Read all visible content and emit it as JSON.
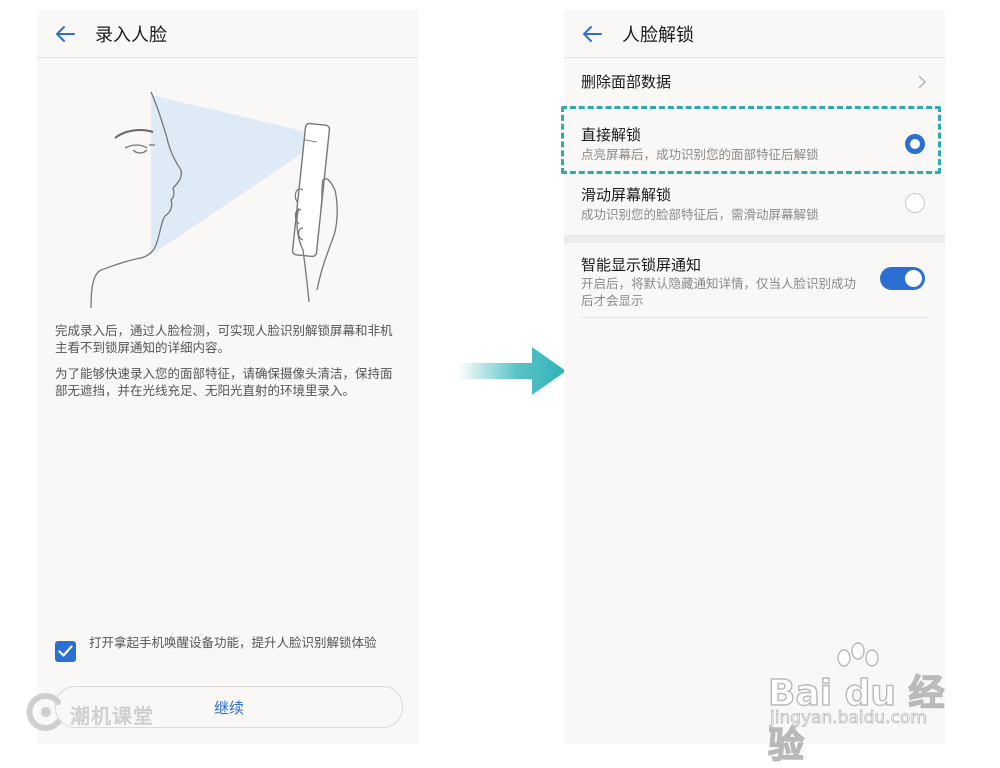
{
  "left_screen": {
    "title": "录入人脸",
    "description_1": "完成录入后，通过人脸检测，可实现人脸识别解锁屏幕和非机主看不到锁屏通知的详细内容。",
    "description_2": "为了能够快速录入您的面部特征，请确保摄像头清洁，保持面部无遮挡，并在光线充足、无阳光直射的环境里录入。",
    "checkbox_label": "打开拿起手机唤醒设备功能，提升人脸识别解锁体验",
    "checkbox_checked": true,
    "continue_label": "继续",
    "watermark": "潮机课堂"
  },
  "right_screen": {
    "title": "人脸解锁",
    "items": [
      {
        "title": "删除面部数据"
      },
      {
        "title": "直接解锁",
        "subtitle": "点亮屏幕后，成功识别您的面部特征后解锁",
        "selected": true
      },
      {
        "title": "滑动屏幕解锁",
        "subtitle": "成功识别您的脸部特征后，需滑动屏幕解锁",
        "selected": false
      }
    ],
    "smart_notification": {
      "title": "智能显示锁屏通知",
      "subtitle": "开启后，将默认隐藏通知详情，仅当人脸识别成功后才会显示",
      "enabled": true
    }
  },
  "watermark": {
    "brand": "Bai du 经验",
    "url": "jingyan.baidu.com"
  },
  "colors": {
    "accent": "#2c6fd2",
    "highlight_border": "#2fa9b0",
    "arrow": "#2fb3b8"
  }
}
